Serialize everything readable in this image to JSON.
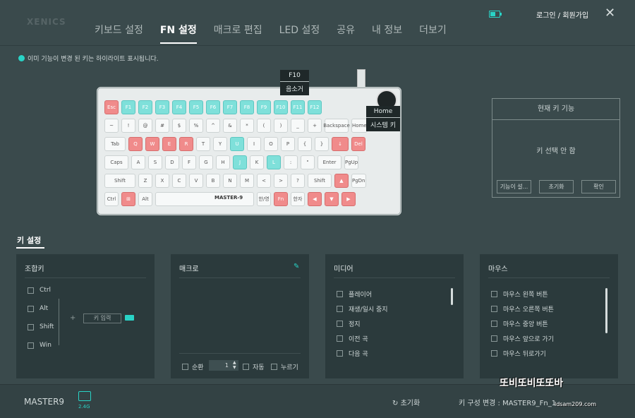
{
  "app": {
    "logo": "XENICS"
  },
  "nav": {
    "tabs": [
      "키보드 설정",
      "FN 설정",
      "매크로 편집",
      "LED 설정",
      "공유",
      "내 정보",
      "더보기"
    ],
    "active": "FN 설정"
  },
  "header": {
    "login": "로그인 / 회원가입",
    "close": "✕"
  },
  "notice": "이미 기능이 변경 된 키는 하이라이트 표시됩니다.",
  "tooltips": {
    "f10": {
      "key": "F10",
      "func": "음소거"
    },
    "home": {
      "key": "Home",
      "func": "시스템 키"
    }
  },
  "keyboard": {
    "brand": "MASTER-9",
    "rows": [
      [
        {
          "l": "Esc",
          "c": "r"
        },
        {
          "l": "F1",
          "c": "t"
        },
        {
          "l": "F2",
          "c": "t"
        },
        {
          "l": "F3",
          "c": "t"
        },
        {
          "l": "F4",
          "c": "t"
        },
        {
          "l": "F5",
          "c": "t"
        },
        {
          "l": "F6",
          "c": "t"
        },
        {
          "l": "F7",
          "c": "t"
        },
        {
          "l": "F8",
          "c": "t"
        },
        {
          "l": "F9",
          "c": "t"
        },
        {
          "l": "F10",
          "c": "t"
        },
        {
          "l": "F11",
          "c": "t"
        },
        {
          "l": "F12",
          "c": "t"
        }
      ],
      [
        {
          "l": "~"
        },
        {
          "l": "!"
        },
        {
          "l": "@"
        },
        {
          "l": "#"
        },
        {
          "l": "$"
        },
        {
          "l": "%"
        },
        {
          "l": "^"
        },
        {
          "l": "&"
        },
        {
          "l": "*"
        },
        {
          "l": "("
        },
        {
          "l": ")"
        },
        {
          "l": "_"
        },
        {
          "l": "+"
        },
        {
          "l": "Backspace",
          "w": 34
        },
        {
          "l": "Home"
        }
      ],
      [
        {
          "l": "Tab",
          "w": 30
        },
        {
          "l": "Q",
          "c": "r"
        },
        {
          "l": "W",
          "c": "r"
        },
        {
          "l": "E",
          "c": "r"
        },
        {
          "l": "R",
          "c": "r"
        },
        {
          "l": "T"
        },
        {
          "l": "Y"
        },
        {
          "l": "U",
          "c": "t"
        },
        {
          "l": "I"
        },
        {
          "l": "O"
        },
        {
          "l": "P"
        },
        {
          "l": "{"
        },
        {
          "l": "}"
        },
        {
          "l": "↓",
          "c": "r",
          "w": 24
        },
        {
          "l": "Del",
          "c": "r"
        }
      ],
      [
        {
          "l": "Caps",
          "w": 34
        },
        {
          "l": "A"
        },
        {
          "l": "S"
        },
        {
          "l": "D"
        },
        {
          "l": "F"
        },
        {
          "l": "G"
        },
        {
          "l": "H"
        },
        {
          "l": "J",
          "c": "t"
        },
        {
          "l": "K"
        },
        {
          "l": "L",
          "c": "t"
        },
        {
          "l": ":"
        },
        {
          "l": "\""
        },
        {
          "l": "Enter",
          "w": 34
        },
        {
          "l": "PgUp"
        }
      ],
      [
        {
          "l": "Shift",
          "w": 44
        },
        {
          "l": "Z"
        },
        {
          "l": "X"
        },
        {
          "l": "C"
        },
        {
          "l": "V"
        },
        {
          "l": "B"
        },
        {
          "l": "N"
        },
        {
          "l": "M"
        },
        {
          "l": "<"
        },
        {
          "l": ">"
        },
        {
          "l": "?"
        },
        {
          "l": "Shift",
          "w": 34
        },
        {
          "l": "▲",
          "c": "r"
        },
        {
          "l": "PgDn"
        }
      ],
      [
        {
          "l": "Ctrl"
        },
        {
          "l": "⊞",
          "c": "r"
        },
        {
          "l": "Alt"
        },
        {
          "l": "",
          "w": 140
        },
        {
          "l": "한/영"
        },
        {
          "l": "Fn",
          "c": "r"
        },
        {
          "l": "한자"
        },
        {
          "l": "◀",
          "c": "r"
        },
        {
          "l": "▼",
          "c": "r"
        },
        {
          "l": "▶",
          "c": "r"
        }
      ]
    ]
  },
  "current_fn": {
    "title": "현재 키 기능",
    "value": "키 선택 안 함",
    "buttons": [
      "기능이 설...",
      "초기화",
      "확인"
    ]
  },
  "key_settings": {
    "title": "키 설정"
  },
  "combo": {
    "title": "조합키",
    "items": [
      "Ctrl",
      "Alt",
      "Shift",
      "Win"
    ],
    "plus": "+",
    "input_label": "키 입력"
  },
  "macro": {
    "title": "매크로",
    "loop_label": "순환",
    "loop_value": "1",
    "auto_label": "자동",
    "press_label": "누르기"
  },
  "media": {
    "title": "미디어",
    "items": [
      "플레이어",
      "재생/일시 중지",
      "정지",
      "이전 곡",
      "다음 곡"
    ]
  },
  "mouse": {
    "title": "마우스",
    "items": [
      "마우스 왼쪽 버튼",
      "마우스 오른쪽 버튼",
      "마우스 중앙 버튼",
      "마우스 앞으로 가기",
      "마우스 뒤로가기"
    ]
  },
  "footer": {
    "device": "MASTER9",
    "wireless": "2.4G",
    "reset": "초기화",
    "keycfg": "키 구성 변경 : MASTER9_Fn_1"
  },
  "watermark": {
    "text": "또비또비또또바",
    "url": "ldsam209.com"
  },
  "colors": {
    "accent": "#29d3c6",
    "red_key": "#f08b8b",
    "teal_key": "#7fe0da"
  }
}
